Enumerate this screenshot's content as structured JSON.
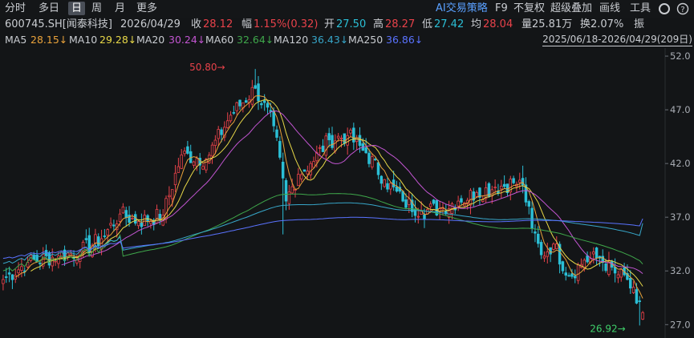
{
  "toolbar": {
    "tabs": [
      "分时",
      "多日",
      "日",
      "周",
      "月",
      "更多"
    ],
    "active_tab": "日",
    "ai_label": "AI交易策略",
    "f9": "F9",
    "fuquan": "不复权",
    "overlay": "超级叠加",
    "drawline": "画线",
    "tools": "工具"
  },
  "quote": {
    "code_name": "600745.SH[闻泰科技]",
    "date": "2026/04/29",
    "close_label": "收",
    "close": "28.12",
    "change_label": "幅",
    "change": "1.15%(0.32)",
    "open_label": "开",
    "open": "27.50",
    "high_label": "高",
    "high": "28.27",
    "low_label": "低",
    "low": "27.42",
    "avg_label": "均",
    "avg": "28.04",
    "volume": "量25.81万",
    "turnover": "换2.07%",
    "amp_label": "振"
  },
  "ma_legend": [
    {
      "label": "MA5",
      "value": "28.15↓",
      "color": "#e9a23b"
    },
    {
      "label": "MA10",
      "value": "29.28↓",
      "color": "#e8d848"
    },
    {
      "label": "MA20",
      "value": "30.24↓",
      "color": "#c255d1"
    },
    {
      "label": "MA60",
      "value": "32.64↓",
      "color": "#3fa84b"
    },
    {
      "label": "MA120",
      "value": "36.43↓",
      "color": "#37a6c9"
    },
    {
      "label": "MA250",
      "value": "36.86↓",
      "color": "#5a73ff"
    }
  ],
  "range_label": "2025/06/18-2026/04/29(209日)",
  "colors": {
    "up": "#e8424a",
    "down": "#2bbfd6",
    "label": "#c9ccd1"
  },
  "chart_data": {
    "type": "candlestick",
    "ylim": [
      26.5,
      52.6
    ],
    "yticks": [
      27.0,
      32.0,
      37.0,
      42.0,
      47.0,
      52.0
    ],
    "annotations": [
      {
        "text": "50.80",
        "value": 50.8,
        "position": "high"
      },
      {
        "text": "26.92",
        "value": 26.92,
        "position": "low"
      }
    ],
    "anchors": [
      {
        "i": 0,
        "c": 31.2
      },
      {
        "i": 8,
        "c": 32.8
      },
      {
        "i": 18,
        "c": 33.4
      },
      {
        "i": 25,
        "c": 33.8
      },
      {
        "i": 32,
        "c": 35.0
      },
      {
        "i": 38,
        "c": 37.3
      },
      {
        "i": 44,
        "c": 36.6
      },
      {
        "i": 52,
        "c": 37.2
      },
      {
        "i": 58,
        "c": 42.8
      },
      {
        "i": 66,
        "c": 42.4
      },
      {
        "i": 74,
        "c": 46.5
      },
      {
        "i": 82,
        "c": 49.0
      },
      {
        "i": 88,
        "c": 45.5
      },
      {
        "i": 92,
        "c": 38.5
      },
      {
        "i": 96,
        "c": 41.0
      },
      {
        "i": 100,
        "c": 42.0
      },
      {
        "i": 106,
        "c": 44.2
      },
      {
        "i": 112,
        "c": 44.6
      },
      {
        "i": 118,
        "c": 43.0
      },
      {
        "i": 124,
        "c": 40.5
      },
      {
        "i": 130,
        "c": 38.5
      },
      {
        "i": 136,
        "c": 37.6
      },
      {
        "i": 142,
        "c": 37.8
      },
      {
        "i": 148,
        "c": 38.5
      },
      {
        "i": 154,
        "c": 39.3
      },
      {
        "i": 160,
        "c": 39.8
      },
      {
        "i": 166,
        "c": 40.2
      },
      {
        "i": 169,
        "c": 40.0
      },
      {
        "i": 172,
        "c": 36.0
      },
      {
        "i": 175,
        "c": 33.5
      },
      {
        "i": 179,
        "c": 34.5
      },
      {
        "i": 184,
        "c": 31.5
      },
      {
        "i": 189,
        "c": 33.0
      },
      {
        "i": 194,
        "c": 33.2
      },
      {
        "i": 199,
        "c": 31.8
      },
      {
        "i": 203,
        "c": 31.2
      },
      {
        "i": 206,
        "c": 29.0
      },
      {
        "i": 208,
        "c": 28.12
      }
    ],
    "ma_final": {
      "MA60": 32.64,
      "MA120": 36.43,
      "MA250": 36.86
    },
    "ma_start": {
      "MA60": 33.0,
      "MA120": 33.5,
      "MA250": 33.6
    }
  }
}
